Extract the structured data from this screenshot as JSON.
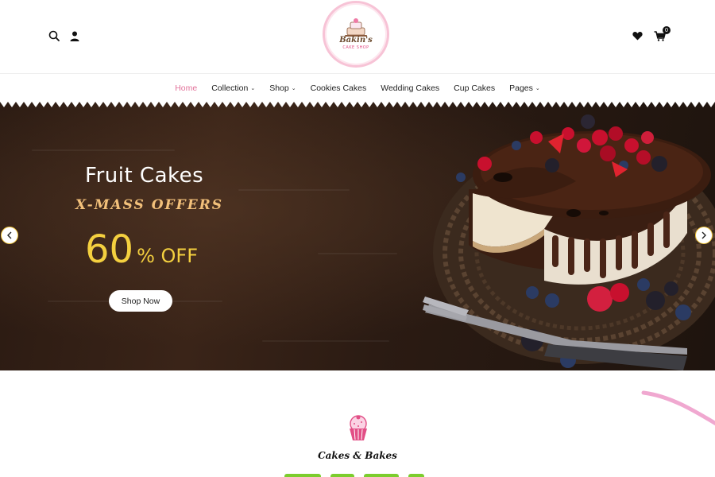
{
  "header": {
    "logo": {
      "name": "Bakin's",
      "sub": "CAKE SHOP"
    },
    "left_icons": [
      "search-icon",
      "user-icon"
    ],
    "right_icons": [
      "heart-icon",
      "cart-icon"
    ],
    "cart_count": "0"
  },
  "nav": {
    "items": [
      {
        "label": "Home",
        "active": true,
        "dropdown": false
      },
      {
        "label": "Collection",
        "active": false,
        "dropdown": true
      },
      {
        "label": "Shop",
        "active": false,
        "dropdown": true
      },
      {
        "label": "Cookies Cakes",
        "active": false,
        "dropdown": false
      },
      {
        "label": "Wedding Cakes",
        "active": false,
        "dropdown": false
      },
      {
        "label": "Cup Cakes",
        "active": false,
        "dropdown": false
      },
      {
        "label": "Pages",
        "active": false,
        "dropdown": true
      }
    ]
  },
  "hero": {
    "title": "Fruit Cakes",
    "subtitle": "X-MASS OFFERS",
    "offer_number": "60",
    "offer_rest": "% OFF",
    "button": "Shop Now",
    "prev_icon": "chevron-left-icon",
    "next_icon": "chevron-right-icon"
  },
  "section": {
    "icon": "cupcake-icon",
    "tagline": "Cakes & Bakes"
  },
  "colors": {
    "accent_pink": "#e2729a",
    "offer_yellow": "#f4d03f",
    "subtitle_gold": "#f2c07a",
    "heading_green": "#7ccd2e"
  }
}
